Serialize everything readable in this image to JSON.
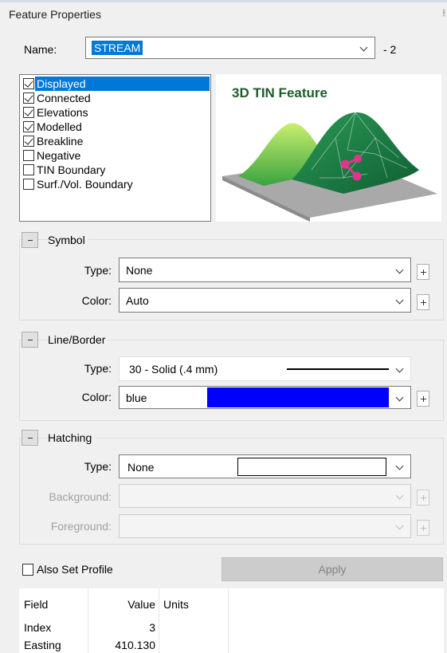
{
  "panel": {
    "title": "Feature Properties",
    "pin_glyph": "⫲"
  },
  "name_row": {
    "label": "Name:",
    "value": "STREAM",
    "suffix": "- 2"
  },
  "flags": [
    {
      "label": "Displayed",
      "checked": true,
      "selected": true
    },
    {
      "label": "Connected",
      "checked": true
    },
    {
      "label": "Elevations",
      "checked": true
    },
    {
      "label": "Modelled",
      "checked": true
    },
    {
      "label": "Breakline",
      "checked": true
    },
    {
      "label": "Negative",
      "checked": false
    },
    {
      "label": "TIN Boundary",
      "checked": false
    },
    {
      "label": "Surf./Vol. Boundary",
      "checked": false
    }
  ],
  "preview": {
    "title": "3D TIN Feature"
  },
  "symbol": {
    "title": "Symbol",
    "type_label": "Type:",
    "type_value": "None",
    "color_label": "Color:",
    "color_value": "Auto"
  },
  "line_border": {
    "title": "Line/Border",
    "type_label": "Type:",
    "type_value": "30 - Solid (.4 mm)",
    "color_label": "Color:",
    "color_value": "blue",
    "color_swatch": "#0000ff"
  },
  "hatching": {
    "title": "Hatching",
    "type_label": "Type:",
    "type_value": "None",
    "background_label": "Background:",
    "foreground_label": "Foreground:"
  },
  "also_set_profile": {
    "label": "Also Set Profile",
    "checked": false
  },
  "apply_button": {
    "label": "Apply"
  },
  "grid": {
    "columns": [
      "Field",
      "Value",
      "Units"
    ],
    "rows": [
      {
        "field": "Index",
        "value": "3",
        "units": ""
      },
      {
        "field": "Easting",
        "value": "410.130",
        "units": ""
      }
    ]
  },
  "colors": {
    "selection": "#0078d7",
    "preview_title": "#1f5d2a",
    "line_swatch": "#0000ff"
  }
}
